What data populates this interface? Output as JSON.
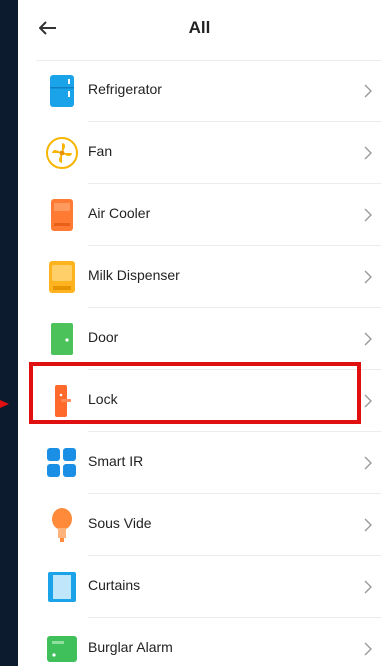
{
  "header": {
    "title": "All",
    "back_icon": "back-arrow-icon"
  },
  "items": [
    {
      "label": "Refrigerator",
      "icon": "refrigerator-icon"
    },
    {
      "label": "Fan",
      "icon": "fan-icon"
    },
    {
      "label": "Air Cooler",
      "icon": "air-cooler-icon"
    },
    {
      "label": "Milk Dispenser",
      "icon": "milk-dispenser-icon"
    },
    {
      "label": "Door",
      "icon": "door-icon"
    },
    {
      "label": "Lock",
      "icon": "lock-icon",
      "highlighted": true
    },
    {
      "label": "Smart IR",
      "icon": "smart-ir-icon"
    },
    {
      "label": "Sous Vide",
      "icon": "sous-vide-icon"
    },
    {
      "label": "Curtains",
      "icon": "curtains-icon"
    },
    {
      "label": "Burglar Alarm",
      "icon": "burglar-alarm-icon"
    }
  ],
  "colors": {
    "highlight": "#e01010",
    "background": "#0d1b2e"
  }
}
